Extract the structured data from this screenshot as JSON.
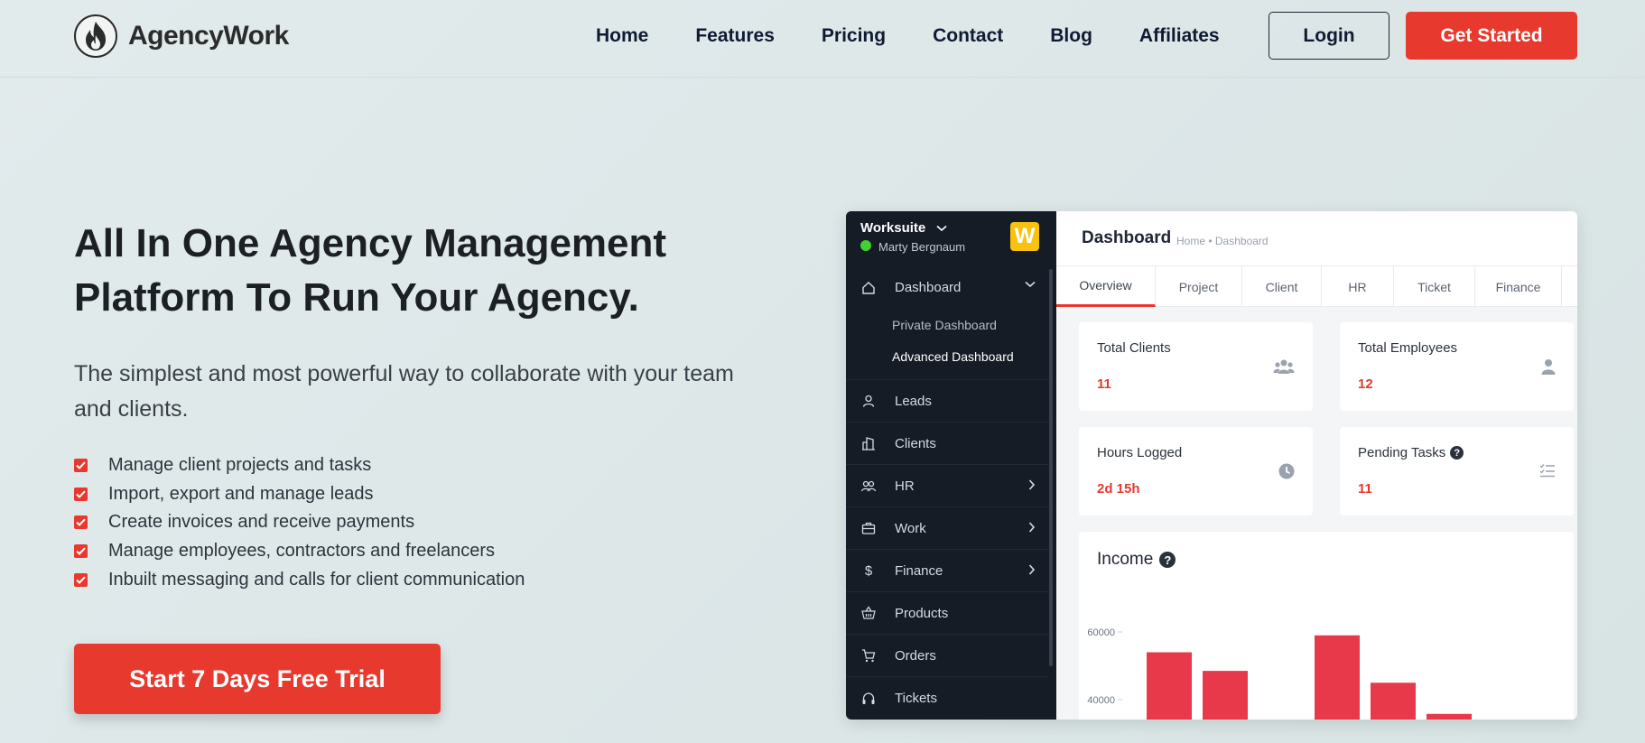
{
  "header": {
    "brand": "AgencyWork",
    "nav": [
      "Home",
      "Features",
      "Pricing",
      "Contact",
      "Blog",
      "Affiliates"
    ],
    "login_label": "Login",
    "get_started_label": "Get Started"
  },
  "hero": {
    "title_line1": "All In One Agency Management",
    "title_line2": "Platform To Run Your Agency.",
    "subtitle": "The simplest and most powerful way to collaborate with your team and clients.",
    "features": [
      "Manage client projects and tasks",
      "Import, export and manage leads",
      "Create invoices and receive payments",
      "Manage employees, contractors and freelancers",
      "Inbuilt messaging and calls for client communication"
    ],
    "cta_label": "Start 7 Days Free Trial"
  },
  "app": {
    "workspace": "Worksuite",
    "workspace_logo": "W",
    "user": "Marty Bergnaum",
    "menu": {
      "dashboard": "Dashboard",
      "private_dashboard": "Private Dashboard",
      "advanced_dashboard": "Advanced Dashboard",
      "leads": "Leads",
      "clients": "Clients",
      "hr": "HR",
      "work": "Work",
      "finance": "Finance",
      "products": "Products",
      "orders": "Orders",
      "tickets": "Tickets"
    },
    "page_title": "Dashboard",
    "breadcrumb": "Home • Dashboard",
    "tabs": [
      "Overview",
      "Project",
      "Client",
      "HR",
      "Ticket",
      "Finance"
    ],
    "cards": {
      "total_clients_label": "Total Clients",
      "total_clients_value": "11",
      "total_employees_label": "Total Employees",
      "total_employees_value": "12",
      "hours_logged_label": "Hours Logged",
      "hours_logged_value": "2d 15h",
      "pending_tasks_label": "Pending Tasks",
      "pending_tasks_value": "11"
    },
    "income_title": "Income",
    "accent": "#e8392f"
  },
  "chart_data": {
    "type": "bar",
    "title": "Income",
    "y_ticks": [
      60000,
      40000
    ],
    "ylim": [
      35000,
      65000
    ],
    "values": [
      54000,
      48500,
      null,
      59000,
      45000,
      35800
    ],
    "color": "#e8394a"
  }
}
